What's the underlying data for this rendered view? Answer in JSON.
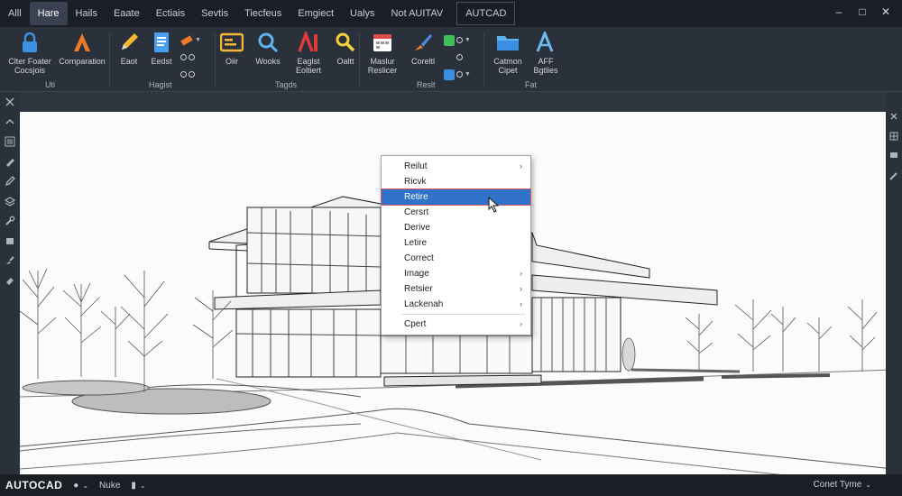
{
  "tabs": [
    "Alll",
    "Hare",
    "Hails",
    "Eaate",
    "Ectiais",
    "Sevtis",
    "Tiecfeus",
    "Emgiect",
    "Ualys",
    "Not AUITAV",
    "AUTCAD"
  ],
  "active_tab_index": 1,
  "window_controls": [
    "–",
    "□",
    "✕"
  ],
  "ribbon": {
    "tools": [
      {
        "label": "Clter Foater\nCocsjois",
        "icon": "lock-icon"
      },
      {
        "label": "Comparation",
        "icon": "letter-a-icon"
      },
      {
        "label": "Eaot",
        "icon": "pencil-icon"
      },
      {
        "label": "Eedst",
        "icon": "document-icon"
      },
      {
        "label": "Oiir",
        "icon": "panel-icon"
      },
      {
        "label": "Wooks",
        "icon": "magnifier-icon"
      },
      {
        "label": "Eaglst\nEoltiert",
        "icon": "text-style-icon"
      },
      {
        "label": "Oaltt",
        "icon": "find-icon"
      },
      {
        "label": "Maslur\nReslicer",
        "icon": "calendar-icon"
      },
      {
        "label": "Coreltl",
        "icon": "brush-icon"
      },
      {
        "label": "Catmon\nCipet",
        "icon": "folder-icon"
      },
      {
        "label": "AFF\nBgtlies",
        "icon": "text-a-icon"
      }
    ],
    "groups": [
      "Uti",
      "Hagist",
      "Tagds",
      "Reslt",
      "Fat"
    ]
  },
  "context_menu": {
    "items": [
      {
        "label": "Reilut",
        "submenu": true
      },
      {
        "label": "Ricvk",
        "submenu": false
      },
      {
        "label": "Retire",
        "submenu": false,
        "highlighted": true
      },
      {
        "label": "Cersrt",
        "submenu": false
      },
      {
        "label": "Derive",
        "submenu": false
      },
      {
        "label": "Letire",
        "submenu": false
      },
      {
        "label": "Correct",
        "submenu": false
      },
      {
        "label": "Image",
        "submenu": true
      },
      {
        "label": "Retsier",
        "submenu": true
      },
      {
        "label": "Lackenah",
        "submenu": true
      },
      {
        "label": "Cpert",
        "submenu": true,
        "separator_before": true
      }
    ]
  },
  "status_bar": {
    "app_name": "AUTOCAD",
    "mode_label": "Nuke",
    "right_label": "Conet Tyme"
  },
  "colors": {
    "highlight": "#2f72c8",
    "ribbon_bg": "#2b313a",
    "canvas_bg": "#fbfbfb"
  }
}
